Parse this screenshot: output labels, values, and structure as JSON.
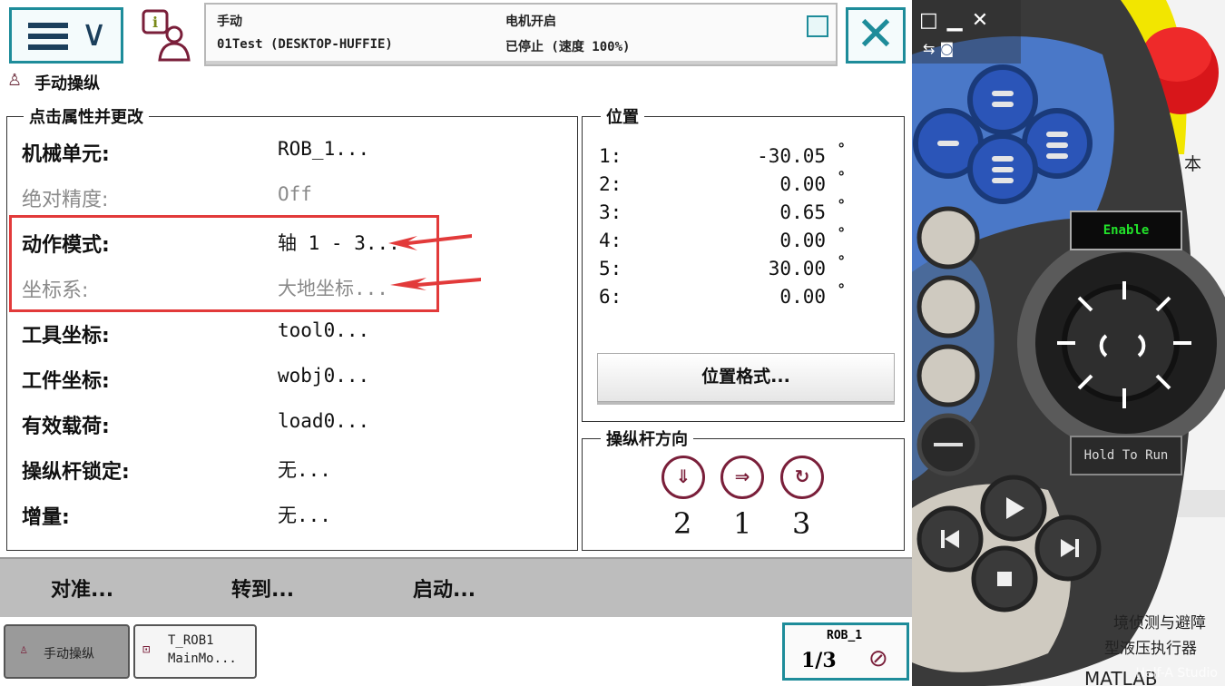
{
  "header": {
    "mode": "手动",
    "controller": "01Test (DESKTOP-HUFFIE)",
    "motor_state": "电机开启",
    "run_state": "已停止 (速度 100%)"
  },
  "app_title": "手动操纵",
  "properties": {
    "legend": "点击属性并更改",
    "rows": [
      {
        "label": "机械单元:",
        "value": "ROB_1..."
      },
      {
        "label": "绝对精度:",
        "value": "Off"
      },
      {
        "label": "动作模式:",
        "value": "轴 1 - 3..."
      },
      {
        "label": "坐标系:",
        "value": "大地坐标..."
      },
      {
        "label": "工具坐标:",
        "value": "tool0..."
      },
      {
        "label": "工件坐标:",
        "value": "wobj0..."
      },
      {
        "label": "有效载荷:",
        "value": "load0..."
      },
      {
        "label": "操纵杆锁定:",
        "value": "无..."
      },
      {
        "label": "增量:",
        "value": "无..."
      }
    ]
  },
  "position": {
    "legend": "位置",
    "rows": [
      {
        "axis": "1:",
        "value": "-30.05"
      },
      {
        "axis": "2:",
        "value": "0.00"
      },
      {
        "axis": "3:",
        "value": "0.65"
      },
      {
        "axis": "4:",
        "value": "0.00"
      },
      {
        "axis": "5:",
        "value": "30.00"
      },
      {
        "axis": "6:",
        "value": "0.00"
      }
    ],
    "degree_symbol": "°",
    "format_button": "位置格式..."
  },
  "joystick_direction": {
    "legend": "操纵杆方向",
    "labels": [
      "2",
      "1",
      "3"
    ]
  },
  "commands": {
    "align": "对准...",
    "goto": "转到...",
    "start": "启动..."
  },
  "taskbar": {
    "jog_tab": "手动操纵",
    "task_line1": "T_ROB1",
    "task_line2": "MainMo...",
    "rob_label": "ROB_1",
    "speed_fraction": "1/3"
  },
  "controller": {
    "enable": "Enable",
    "hold_to_run": "Hold To Run"
  },
  "background_fragments": {
    "t1": "本",
    "t2": "境侦测与避障",
    "t3": "型液压执行器",
    "t4": "MATLAB",
    "watermark": "Half-A Studio"
  },
  "colors": {
    "accent": "#1e8c9a",
    "highlight": "#e23a3a",
    "enable_text": "#22e22a"
  }
}
